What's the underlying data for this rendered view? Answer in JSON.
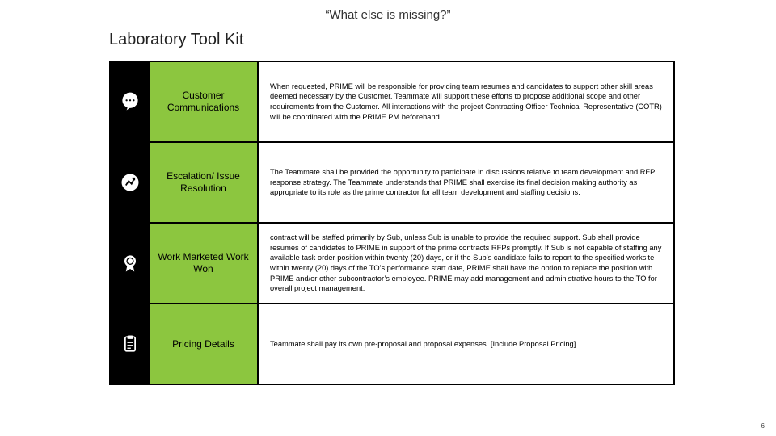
{
  "tagline": "“What else is missing?”",
  "heading": "Laboratory Tool Kit",
  "rows": [
    {
      "icon": "speech-bubble-icon",
      "label": "Customer Communications",
      "desc": "When requested, PRIME will be responsible for providing team resumes and candidates to support other skill areas deemed necessary by the Customer. Teammate will support these efforts to propose additional scope and other requirements from the Customer. All interactions with the project Contracting Officer Technical Representative (COTR) will be coordinated with the PRIME PM beforehand"
    },
    {
      "icon": "escalation-icon",
      "label": "Escalation/ Issue Resolution",
      "desc": "The Teammate shall be provided the opportunity to participate in discussions relative to team development and RFP response strategy. The Teammate understands that PRIME shall exercise its final decision making authority as appropriate to its role as the prime contractor for all team development and staffing decisions."
    },
    {
      "icon": "award-icon",
      "label": "Work Marketed Work Won",
      "desc": "contract will be staffed primarily by Sub, unless Sub is unable to provide the required support. Sub shall provide resumes of candidates to PRIME in support of the prime contracts RFPs promptly. If Sub is not capable of staffing any available task order position within twenty (20) days, or if the Sub’s candidate fails to report to the specified worksite within twenty (20) days of the TO’s performance start date, PRIME shall have the option to replace the position with PRIME and/or other subcontractor’s employee. PRIME may add management and administrative hours to the TO for overall project management."
    },
    {
      "icon": "clipboard-icon",
      "label": "Pricing Details",
      "desc": "Teammate shall pay its own pre-proposal and proposal expenses. [Include Proposal Pricing]."
    }
  ],
  "slide_number": "6"
}
